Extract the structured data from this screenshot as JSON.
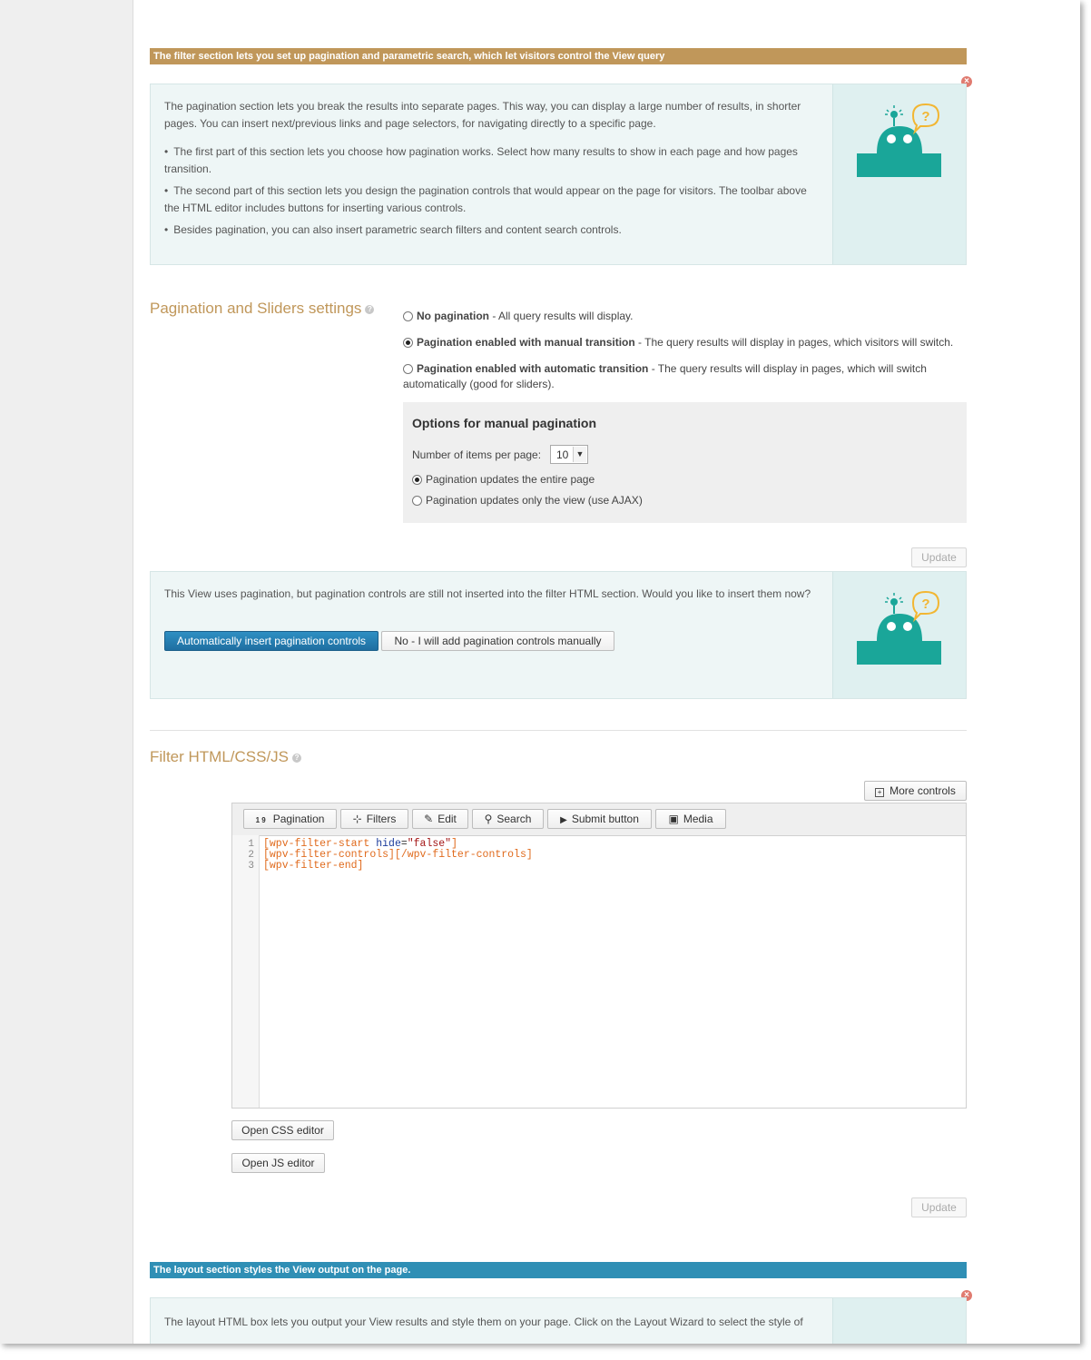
{
  "filter_banner": "The filter section lets you set up pagination and parametric search, which let visitors control the View query",
  "pagination_help": {
    "intro": "The pagination section lets you break the results into separate pages. This way, you can display a large number of results, in shorter pages. You can insert next/previous links and page selectors, for navigating directly to a specific page.",
    "bullets": [
      "The first part of this section lets you choose how pagination works. Select how many results to show in each page and how pages transition.",
      "The second part of this section lets you design the pagination controls that would appear on the page for visitors. The toolbar above the HTML editor includes buttons for inserting various controls.",
      "Besides pagination, you can also insert parametric search filters and content search controls."
    ]
  },
  "pagination_settings": {
    "title": "Pagination and Sliders settings",
    "options": [
      {
        "bold": "No pagination",
        "desc": " - All query results will display."
      },
      {
        "bold": "Pagination enabled with manual transition",
        "desc": " - The query results will display in pages, which visitors will switch."
      },
      {
        "bold": "Pagination enabled with automatic transition",
        "desc": " - The query results will display in pages, which will switch automatically (good for sliders)."
      }
    ],
    "manual": {
      "title": "Options for manual pagination",
      "items_label": "Number of items per page:",
      "items_value": "10",
      "update_entire": "Pagination updates the entire page",
      "update_ajax": "Pagination updates only the view (use AJAX)"
    },
    "update_label": "Update"
  },
  "insert_controls": {
    "text": "This View uses pagination, but pagination controls are still not inserted into the filter HTML section. Would you like to insert them now?",
    "auto_label": "Automatically insert pagination controls",
    "manual_label": "No - I will add pagination controls manually"
  },
  "filter_html": {
    "title": "Filter HTML/CSS/JS",
    "more_controls": "More controls",
    "toolbar": [
      {
        "label": "Pagination",
        "icon": "pagination-icon",
        "glyph": "1 9"
      },
      {
        "label": "Filters",
        "icon": "filters-icon",
        "glyph": "⊹"
      },
      {
        "label": "Edit",
        "icon": "edit-icon",
        "glyph": "✎"
      },
      {
        "label": "Search",
        "icon": "search-icon",
        "glyph": "⚲"
      },
      {
        "label": "Submit button",
        "icon": "submit-icon",
        "glyph": "▶"
      },
      {
        "label": "Media",
        "icon": "media-icon",
        "glyph": "▣"
      }
    ],
    "line_numbers": [
      "1",
      "2",
      "3"
    ],
    "code": {
      "l1_a": "[wpv-filter-start ",
      "l1_attr": "hide",
      "l1_eq": "=",
      "l1_val": "\"false\"",
      "l1_b": "]",
      "l2": "[wpv-filter-controls][/wpv-filter-controls]",
      "l3": "[wpv-filter-end]"
    },
    "css_editor": "Open CSS editor",
    "js_editor": "Open JS editor",
    "update_label": "Update"
  },
  "layout_banner": "The layout section styles the View output on the page.",
  "layout_help": {
    "intro": "The layout HTML box lets you output your View results and style them on your page. Click on the Layout Wizard to select the style of"
  },
  "colors": {
    "gold": "#c0975a",
    "blue": "#2f8fb5",
    "teal": "#1aa699",
    "yellow": "#f2b632"
  }
}
